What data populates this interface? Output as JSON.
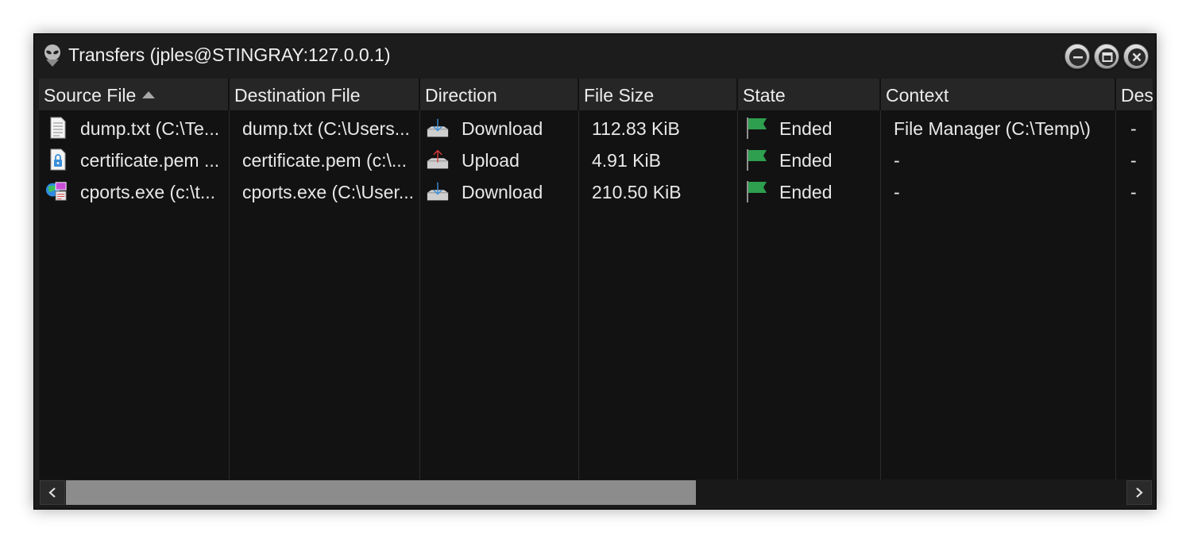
{
  "window": {
    "title": "Transfers (jples@STINGRAY:127.0.0.1)"
  },
  "columns": [
    {
      "label": "Source File",
      "sorted": "ascending"
    },
    {
      "label": "Destination File"
    },
    {
      "label": "Direction"
    },
    {
      "label": "File Size"
    },
    {
      "label": "State"
    },
    {
      "label": "Context"
    },
    {
      "label": "Des"
    }
  ],
  "rows": [
    {
      "source": "dump.txt (C:\\Te...",
      "source_icon": "text-file-icon",
      "destination": "dump.txt (C:\\Users...",
      "direction": "Download",
      "direction_icon": "download-arrow-icon",
      "size": "112.83 KiB",
      "state": "Ended",
      "state_icon": "green-flag-icon",
      "context": "File Manager (C:\\Temp\\)",
      "description": "-"
    },
    {
      "source": "certificate.pem ...",
      "source_icon": "certificate-file-icon",
      "destination": "certificate.pem (c:\\...",
      "direction": "Upload",
      "direction_icon": "upload-arrow-icon",
      "size": "4.91 KiB",
      "state": "Ended",
      "state_icon": "green-flag-icon",
      "context": "-",
      "description": "-"
    },
    {
      "source": "cports.exe (c:\\t...",
      "source_icon": "executable-file-icon",
      "destination": "cports.exe (C:\\User...",
      "direction": "Download",
      "direction_icon": "download-arrow-icon",
      "size": "210.50 KiB",
      "state": "Ended",
      "state_icon": "green-flag-icon",
      "context": "-",
      "description": "-"
    }
  ],
  "scrollbar": {
    "left_icon": "chevron-left-icon",
    "right_icon": "chevron-right-icon",
    "position": 0.0
  },
  "colors": {
    "window_bg": "#1b1b1b",
    "grid_bg": "#121212",
    "header_bg": "#262626",
    "flag_green": "#2e9e4f",
    "download_blue": "#3a8fd8",
    "upload_red": "#d83a3a"
  }
}
